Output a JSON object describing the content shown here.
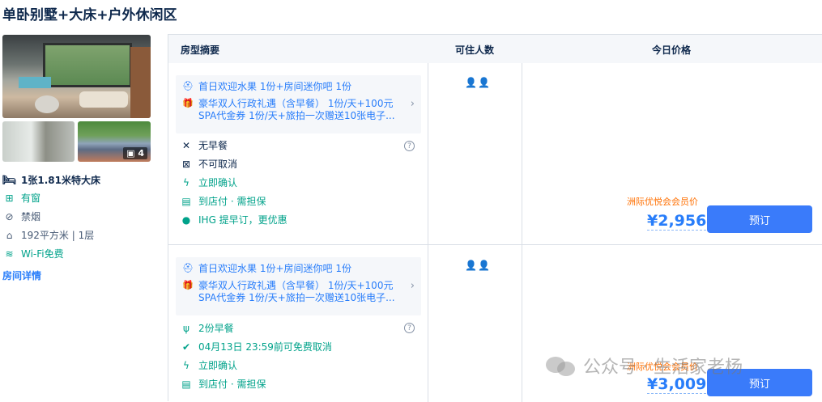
{
  "room": {
    "title": "单卧别墅+大床+户外休闲区",
    "photo_count": "4",
    "amenities": {
      "bed": "1张1.81米特大床",
      "window": "有窗",
      "smoking": "禁烟",
      "area": "192平方米 | 1层",
      "wifi": "Wi-Fi免费"
    },
    "detail_link": "房间详情"
  },
  "table": {
    "headers": {
      "summary": "房型摘要",
      "occupancy": "可住人数",
      "price": "今日价格"
    },
    "rows": [
      {
        "pkg": {
          "line1": "首日欢迎水果 1份+房间迷你吧 1份",
          "line2": "豪华双人行政礼遇（含早餐） 1份/天+100元",
          "line3": "SPA代金券 1份/天+旅拍一次赠送10张电子..."
        },
        "meal": "无早餐",
        "cancel": "不可取消",
        "confirm": "立即确认",
        "payment": "到店付 · 需担保",
        "ihg": "IHG 提早订，更优惠",
        "occupancy": "👤👤",
        "member_tag": "洲际优悦会会员价",
        "price": "¥2,956",
        "book": "预订"
      },
      {
        "pkg": {
          "line1": "首日欢迎水果 1份+房间迷你吧 1份",
          "line2": "豪华双人行政礼遇（含早餐） 1份/天+100元",
          "line3": "SPA代金券 1份/天+旅拍一次赠送10张电子..."
        },
        "meal": "2份早餐",
        "cancel": "04月13日 23:59前可免费取消",
        "confirm": "立即确认",
        "payment": "到店付 · 需担保",
        "occupancy": "👤👤",
        "member_tag": "洲际优悦会会员价",
        "price": "¥3,009",
        "book": "预订"
      }
    ]
  },
  "watermark": "公众号 · 生活家老杨"
}
